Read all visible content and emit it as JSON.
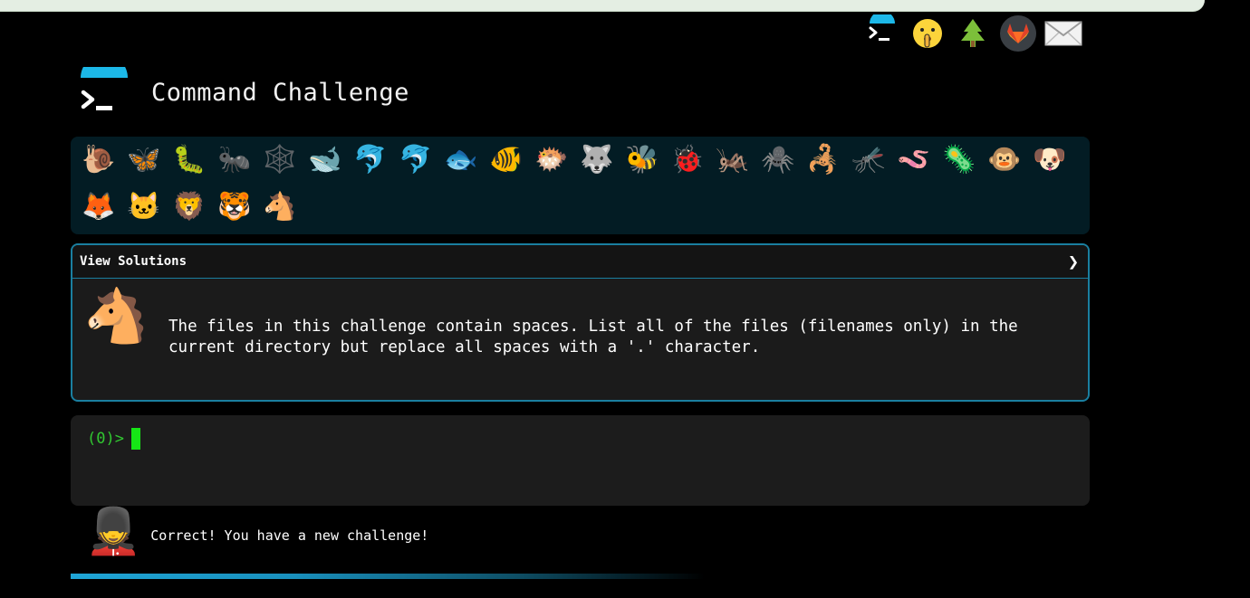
{
  "top_nav": {
    "icons": [
      "command-challenge-logo-icon",
      "shushing-face-icon",
      "tree-icon",
      "gitlab-icon",
      "envelope-icon"
    ]
  },
  "header": {
    "title": "Command Challenge"
  },
  "animals": {
    "row1": [
      "🐌",
      "🦋",
      "🐛",
      "🐜",
      "🕸️",
      "🐋",
      "🐬",
      "🐬",
      "🐟",
      "🐠",
      "🐡",
      "🐺",
      "🐝",
      "🐞",
      "🦗",
      "🕷️",
      "🦂",
      "🦟",
      "🪱",
      "🦠",
      "🐵",
      "🐶"
    ],
    "row2": [
      "🦊",
      "🐱",
      "🦁",
      "🐯",
      "🐴"
    ]
  },
  "solutions": {
    "title": "View Solutions",
    "chevron": "❯"
  },
  "challenge": {
    "icon": "🐴",
    "text": "The files in this challenge contain spaces. List all of the files (filenames only) in the\ncurrent directory but replace all spaces with a '.' character."
  },
  "terminal": {
    "prompt": "(0)>"
  },
  "feedback": {
    "icon": "💂",
    "message": "Correct! You have a new challenge!"
  },
  "colors": {
    "accent": "#1fa5d6",
    "prompt": "#31c831",
    "panel": "#031c24"
  }
}
